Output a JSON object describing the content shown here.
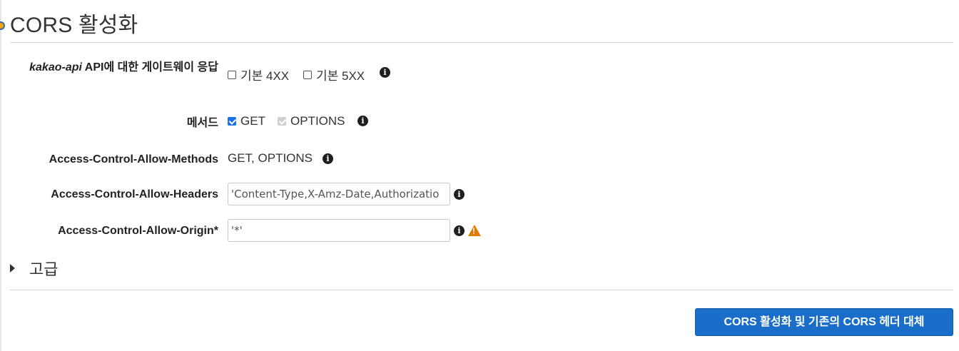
{
  "title": "CORS 활성화",
  "gateway_responses": {
    "label_api": "kakao-api",
    "label_rest": " API에 대한 게이트웨이 응답",
    "options": [
      {
        "label": "기본 4XX",
        "checked": false
      },
      {
        "label": "기본 5XX",
        "checked": false
      }
    ]
  },
  "methods": {
    "label": "메서드",
    "options": [
      {
        "label": "GET",
        "checked": true
      },
      {
        "label": "OPTIONS",
        "checked": true,
        "disabled": true
      }
    ]
  },
  "allow_methods": {
    "label": "Access-Control-Allow-Methods",
    "value": "GET, OPTIONS"
  },
  "allow_headers": {
    "label": "Access-Control-Allow-Headers",
    "value": "'Content-Type,X-Amz-Date,Authorizatio"
  },
  "allow_origin": {
    "label": "Access-Control-Allow-Origin*",
    "value": "'*'"
  },
  "advanced": {
    "label": "고급"
  },
  "submit_button": {
    "label": "CORS 활성화 및 기존의 CORS 헤더 대체"
  },
  "colors": {
    "primary": "#1a6ec9",
    "warning": "#e07b00",
    "checkbox": "#1a73e8"
  }
}
